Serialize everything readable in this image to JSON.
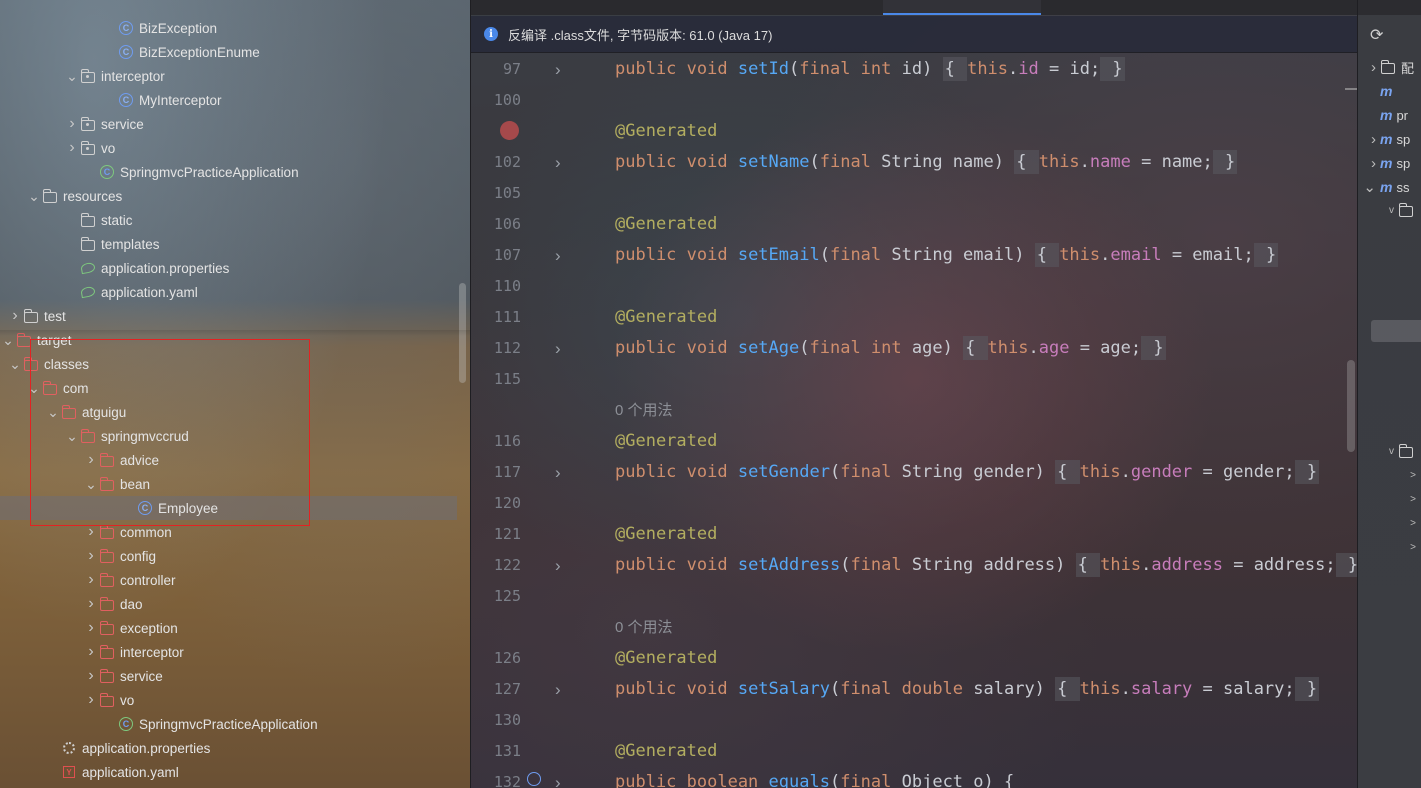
{
  "tree": {
    "items": [
      {
        "label": "BizException",
        "indent": 118,
        "arrow": "",
        "icon": "class"
      },
      {
        "label": "BizExceptionEnume",
        "indent": 118,
        "arrow": "",
        "icon": "class"
      },
      {
        "label": "interceptor",
        "indent": 80,
        "arrow": "v",
        "icon": "package"
      },
      {
        "label": "MyInterceptor",
        "indent": 118,
        "arrow": "",
        "icon": "class"
      },
      {
        "label": "service",
        "indent": 80,
        "arrow": ">",
        "icon": "package"
      },
      {
        "label": "vo",
        "indent": 80,
        "arrow": ">",
        "icon": "package"
      },
      {
        "label": "SpringmvcPracticeApplication",
        "indent": 99,
        "arrow": "",
        "icon": "spring-class"
      },
      {
        "label": "resources",
        "indent": 42,
        "arrow": "v",
        "icon": "resources-folder"
      },
      {
        "label": "static",
        "indent": 80,
        "arrow": "",
        "icon": "folder"
      },
      {
        "label": "templates",
        "indent": 80,
        "arrow": "",
        "icon": "folder"
      },
      {
        "label": "application.properties",
        "indent": 80,
        "arrow": "",
        "icon": "spring-config"
      },
      {
        "label": "application.yaml",
        "indent": 80,
        "arrow": "",
        "icon": "spring-config"
      },
      {
        "label": "test",
        "indent": 23,
        "arrow": ">",
        "icon": "folder"
      },
      {
        "label": "target",
        "indent": 4,
        "arrow": "v",
        "icon": "excluded-folder"
      },
      {
        "label": "classes",
        "indent": 23,
        "arrow": "v",
        "icon": "excluded-folder"
      },
      {
        "label": "com",
        "indent": 42,
        "arrow": "v",
        "icon": "excluded-folder"
      },
      {
        "label": "atguigu",
        "indent": 61,
        "arrow": "v",
        "icon": "excluded-folder"
      },
      {
        "label": "springmvccrud",
        "indent": 80,
        "arrow": "v",
        "icon": "excluded-folder"
      },
      {
        "label": "advice",
        "indent": 99,
        "arrow": ">",
        "icon": "excluded-folder"
      },
      {
        "label": "bean",
        "indent": 99,
        "arrow": "v",
        "icon": "excluded-folder"
      },
      {
        "label": "Employee",
        "indent": 137,
        "arrow": "",
        "icon": "class"
      },
      {
        "label": "common",
        "indent": 99,
        "arrow": ">",
        "icon": "excluded-folder"
      },
      {
        "label": "config",
        "indent": 99,
        "arrow": ">",
        "icon": "excluded-folder"
      },
      {
        "label": "controller",
        "indent": 99,
        "arrow": ">",
        "icon": "excluded-folder"
      },
      {
        "label": "dao",
        "indent": 99,
        "arrow": ">",
        "icon": "excluded-folder"
      },
      {
        "label": "exception",
        "indent": 99,
        "arrow": ">",
        "icon": "excluded-folder"
      },
      {
        "label": "interceptor",
        "indent": 99,
        "arrow": ">",
        "icon": "excluded-folder"
      },
      {
        "label": "service",
        "indent": 99,
        "arrow": ">",
        "icon": "excluded-folder"
      },
      {
        "label": "vo",
        "indent": 99,
        "arrow": ">",
        "icon": "excluded-folder"
      },
      {
        "label": "SpringmvcPracticeApplication",
        "indent": 118,
        "arrow": "",
        "icon": "spring-class"
      },
      {
        "label": "application.properties",
        "indent": 61,
        "arrow": "",
        "icon": "gear"
      },
      {
        "label": "application.yaml",
        "indent": 61,
        "arrow": "",
        "icon": "yaml"
      }
    ],
    "selected_label": "Employee"
  },
  "editor": {
    "banner": "反编译 .class文件, 字节码版本: 61.0 (Java 17)",
    "usage_hint": "0 个用法",
    "lines": [
      {
        "num": "97",
        "kind": "code",
        "fold": true,
        "tokens": [
          [
            "kw",
            "public void "
          ],
          [
            "fn",
            "setId"
          ],
          [
            "",
            "("
          ],
          [
            "kw",
            "final int "
          ],
          [
            "",
            "id)"
          ],
          [
            "sp",
            " "
          ],
          [
            "br",
            "{ "
          ],
          [
            "kw",
            "this"
          ],
          [
            "",
            "."
          ],
          [
            "fd",
            "id"
          ],
          [
            "",
            " = id;"
          ],
          [
            "br",
            " }"
          ]
        ]
      },
      {
        "num": "100",
        "kind": "blank"
      },
      {
        "num": "",
        "kind": "annot",
        "breakpoint": true
      },
      {
        "num": "102",
        "kind": "code",
        "fold": true,
        "tokens": [
          [
            "kw",
            "public void "
          ],
          [
            "fn",
            "setName"
          ],
          [
            "",
            "("
          ],
          [
            "kw",
            "final "
          ],
          [
            "",
            "String name)"
          ],
          [
            "sp",
            " "
          ],
          [
            "br",
            "{ "
          ],
          [
            "kw",
            "this"
          ],
          [
            "",
            "."
          ],
          [
            "fd",
            "name"
          ],
          [
            "",
            " = name;"
          ],
          [
            "br",
            " }"
          ]
        ]
      },
      {
        "num": "105",
        "kind": "blank"
      },
      {
        "num": "106",
        "kind": "annot"
      },
      {
        "num": "107",
        "kind": "code",
        "fold": true,
        "tokens": [
          [
            "kw",
            "public void "
          ],
          [
            "fn",
            "setEmail"
          ],
          [
            "",
            "("
          ],
          [
            "kw",
            "final "
          ],
          [
            "",
            "String email)"
          ],
          [
            "sp",
            " "
          ],
          [
            "br",
            "{ "
          ],
          [
            "kw",
            "this"
          ],
          [
            "",
            "."
          ],
          [
            "fd",
            "email"
          ],
          [
            "",
            " = email;"
          ],
          [
            "br",
            " }"
          ]
        ]
      },
      {
        "num": "110",
        "kind": "blank"
      },
      {
        "num": "111",
        "kind": "annot"
      },
      {
        "num": "112",
        "kind": "code",
        "fold": true,
        "tokens": [
          [
            "kw",
            "public void "
          ],
          [
            "fn",
            "setAge"
          ],
          [
            "",
            "("
          ],
          [
            "kw",
            "final int "
          ],
          [
            "",
            "age)"
          ],
          [
            "sp",
            " "
          ],
          [
            "br",
            "{ "
          ],
          [
            "kw",
            "this"
          ],
          [
            "",
            "."
          ],
          [
            "fd",
            "age"
          ],
          [
            "",
            " = age;"
          ],
          [
            "br",
            " }"
          ]
        ]
      },
      {
        "num": "115",
        "kind": "blank"
      },
      {
        "num": "",
        "kind": "hint"
      },
      {
        "num": "116",
        "kind": "annot"
      },
      {
        "num": "117",
        "kind": "code",
        "fold": true,
        "tokens": [
          [
            "kw",
            "public void "
          ],
          [
            "fn",
            "setGender"
          ],
          [
            "",
            "("
          ],
          [
            "kw",
            "final "
          ],
          [
            "",
            "String gender)"
          ],
          [
            "sp",
            " "
          ],
          [
            "br",
            "{ "
          ],
          [
            "kw",
            "this"
          ],
          [
            "",
            "."
          ],
          [
            "fd",
            "gender"
          ],
          [
            "",
            " = gender;"
          ],
          [
            "br",
            " }"
          ]
        ]
      },
      {
        "num": "120",
        "kind": "blank"
      },
      {
        "num": "121",
        "kind": "annot"
      },
      {
        "num": "122",
        "kind": "code",
        "fold": true,
        "tokens": [
          [
            "kw",
            "public void "
          ],
          [
            "fn",
            "setAddress"
          ],
          [
            "",
            "("
          ],
          [
            "kw",
            "final "
          ],
          [
            "",
            "String address)"
          ],
          [
            "sp",
            " "
          ],
          [
            "br",
            "{ "
          ],
          [
            "kw",
            "this"
          ],
          [
            "",
            "."
          ],
          [
            "fd",
            "address"
          ],
          [
            "",
            " = address;"
          ],
          [
            "br",
            " }"
          ]
        ]
      },
      {
        "num": "125",
        "kind": "blank"
      },
      {
        "num": "",
        "kind": "hint"
      },
      {
        "num": "126",
        "kind": "annot"
      },
      {
        "num": "127",
        "kind": "code",
        "fold": true,
        "tokens": [
          [
            "kw",
            "public void "
          ],
          [
            "fn",
            "setSalary"
          ],
          [
            "",
            "("
          ],
          [
            "kw",
            "final double "
          ],
          [
            "",
            "salary)"
          ],
          [
            "sp",
            " "
          ],
          [
            "br",
            "{ "
          ],
          [
            "kw",
            "this"
          ],
          [
            "",
            "."
          ],
          [
            "fd",
            "salary"
          ],
          [
            "",
            " = salary;"
          ],
          [
            "br",
            " }"
          ]
        ]
      },
      {
        "num": "130",
        "kind": "blank"
      },
      {
        "num": "131",
        "kind": "annot"
      },
      {
        "num": "132",
        "kind": "code",
        "fold": true,
        "tokens": [
          [
            "kw",
            "public boolean "
          ],
          [
            "fn",
            "equals"
          ],
          [
            "",
            "("
          ],
          [
            "kw",
            "final "
          ],
          [
            "",
            "Object o) {"
          ]
        ]
      }
    ],
    "annotation": "@Generated"
  },
  "right_panel": {
    "items": [
      {
        "arrow": ">",
        "icon": "folder",
        "label": "配"
      },
      {
        "arrow": "",
        "icon": "m",
        "label": "m"
      },
      {
        "arrow": "",
        "icon": "m",
        "label": "pr"
      },
      {
        "arrow": ">",
        "icon": "m",
        "label": "sp"
      },
      {
        "arrow": ">",
        "icon": "m",
        "label": "sp"
      },
      {
        "arrow": "v",
        "icon": "m",
        "label": "ss"
      }
    ]
  }
}
